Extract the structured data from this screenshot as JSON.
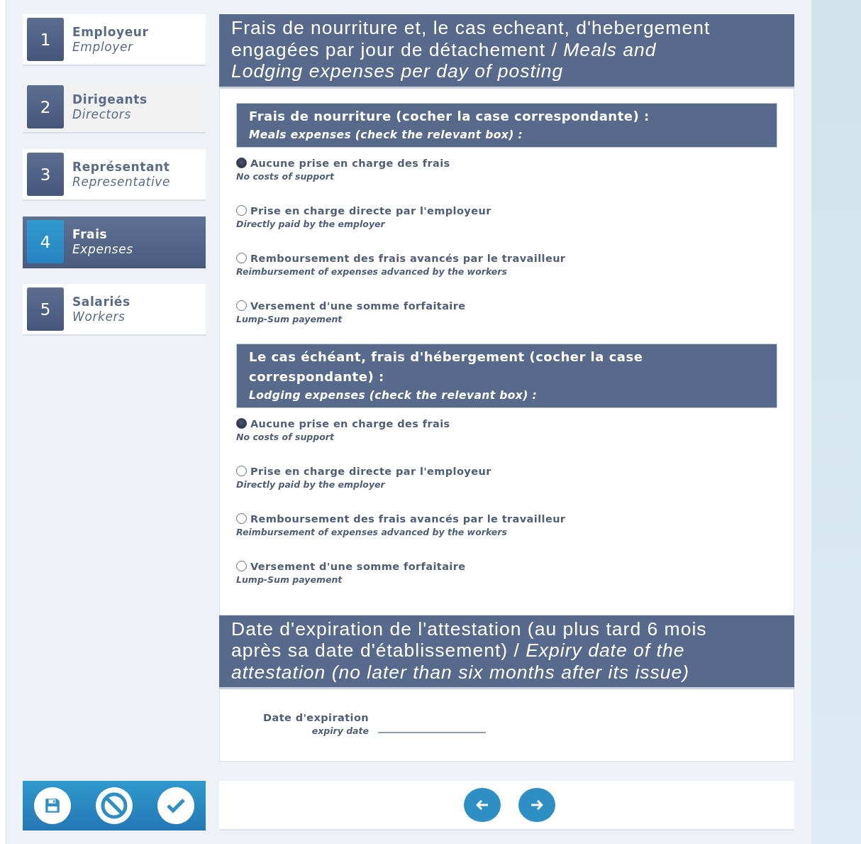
{
  "steps": [
    {
      "number": "1",
      "title": "Employeur",
      "subtitle": "Employer",
      "selected": false,
      "hovered": false
    },
    {
      "number": "2",
      "title": "Dirigeants",
      "subtitle": "Directors",
      "selected": false,
      "hovered": true
    },
    {
      "number": "3",
      "title": "Représentant",
      "subtitle": "Representative",
      "selected": false,
      "hovered": false
    },
    {
      "number": "4",
      "title": "Frais",
      "subtitle": "Expenses",
      "selected": true,
      "hovered": false
    },
    {
      "number": "5",
      "title": "Salariés",
      "subtitle": "Workers",
      "selected": false,
      "hovered": false
    }
  ],
  "sections": [
    {
      "kind": "options",
      "title": "Frais de nourriture et, le cas echeant, d'hebergement engagées par jour de détachement / *Meals and Lodging expenses per day of posting*",
      "groups": [
        {
          "title": "Frais de nourriture (cocher la case correspondante) :",
          "subtitle": "Meals expenses (check the relevant box) :",
          "options": [
            {
              "label": "Aucune prise en charge des frais",
              "sublabel": "No costs of support",
              "selected": true
            },
            {
              "label": "Prise en charge directe par l'employeur",
              "sublabel": "Directly paid by the employer",
              "selected": false
            },
            {
              "label": "Remboursement des frais avancés par le travailleur",
              "sublabel": "Reimbursement of expenses advanced by the workers",
              "selected": false
            },
            {
              "label": "Versement d'une somme forfaitaire",
              "sublabel": "Lump-Sum payement",
              "selected": false
            }
          ]
        },
        {
          "title": "Le cas échéant, frais d'hébergement (cocher la case correspondante) :",
          "subtitle": "Lodging expenses (check the relevant box) :",
          "options": [
            {
              "label": "Aucune prise en charge des frais",
              "sublabel": "No costs of support",
              "selected": true
            },
            {
              "label": "Prise en charge directe par l'employeur",
              "sublabel": "Directly paid by the employer",
              "selected": false
            },
            {
              "label": "Remboursement des frais avancés par le travailleur",
              "sublabel": "Reimbursement of expenses advanced by the workers",
              "selected": false
            },
            {
              "label": "Versement d'une somme forfaitaire",
              "sublabel": "Lump-Sum payement",
              "selected": false
            }
          ]
        }
      ]
    },
    {
      "kind": "date",
      "title": "Date d'expiration de l'attestation (au plus tard 6 mois après sa date d'établissement) / *Expiry date of the attestation (no later than six months after its issue)*",
      "field": {
        "label": "Date d'expiration",
        "sublabel": "expiry date"
      }
    }
  ]
}
